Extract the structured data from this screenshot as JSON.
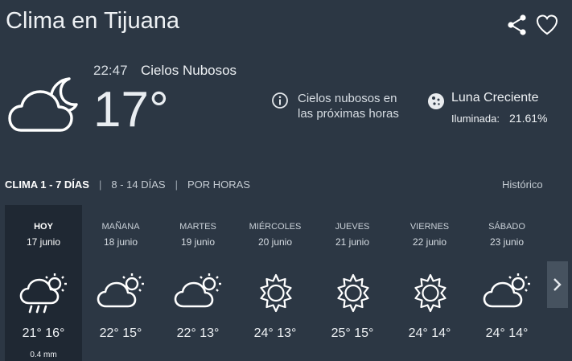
{
  "header": {
    "title": "Clima en Tijuana",
    "share_icon": "share-icon",
    "favorite_icon": "heart-icon"
  },
  "current": {
    "time": "22:47",
    "description": "Cielos Nubosos",
    "temperature": "17°",
    "icon": "partly-cloudy-night-icon"
  },
  "forecast_summary": {
    "icon": "info-icon",
    "text": "Cielos nubosos en las próximas horas"
  },
  "moon": {
    "icon": "moon-icon",
    "phase": "Luna Creciente",
    "illumination_label": "Iluminada:",
    "illumination_value": "21.61%"
  },
  "tabs": [
    {
      "label": "CLIMA 1 - 7 DÍAS",
      "active": true
    },
    {
      "label": "8 - 14 DÍAS",
      "active": false
    },
    {
      "label": "POR HORAS",
      "active": false
    }
  ],
  "historico": "Histórico",
  "days": [
    {
      "name": "HOY",
      "date": "17 junio",
      "temps": "21° 16°",
      "rain": "0.4 mm",
      "icon": "cloud-sun-rain-icon"
    },
    {
      "name": "MAÑANA",
      "date": "18 junio",
      "temps": "22° 15°",
      "icon": "cloud-sun-icon"
    },
    {
      "name": "MARTES",
      "date": "19 junio",
      "temps": "22° 13°",
      "icon": "cloud-sun-icon"
    },
    {
      "name": "MIÉRCOLES",
      "date": "20 junio",
      "temps": "24° 13°",
      "icon": "sun-icon"
    },
    {
      "name": "JUEVES",
      "date": "21 junio",
      "temps": "25° 15°",
      "icon": "sun-icon"
    },
    {
      "name": "VIERNES",
      "date": "22 junio",
      "temps": "24° 14°",
      "icon": "sun-icon"
    },
    {
      "name": "SÁBADO",
      "date": "23 junio",
      "temps": "24° 14°",
      "icon": "cloud-sun-icon"
    }
  ],
  "next_icon": "chevron-right-icon",
  "colors": {
    "background": "#2c3744",
    "today_background": "#1f2833",
    "text": "#eef1f4"
  }
}
